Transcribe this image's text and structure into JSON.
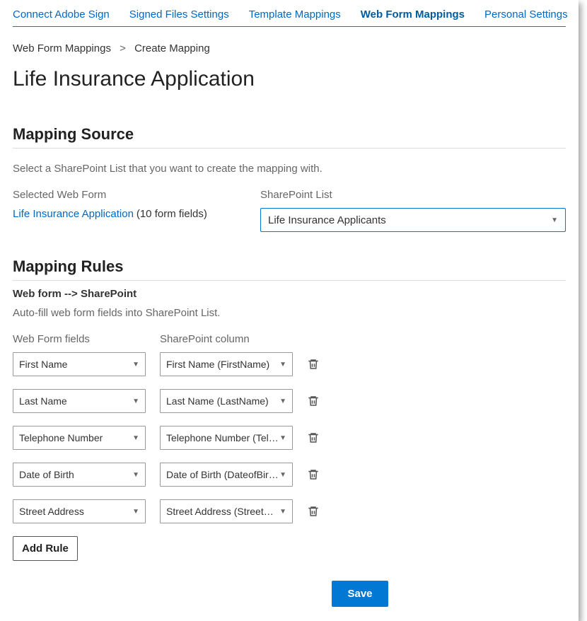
{
  "tabs": [
    {
      "label": "Connect Adobe Sign",
      "active": false
    },
    {
      "label": "Signed Files Settings",
      "active": false
    },
    {
      "label": "Template Mappings",
      "active": false
    },
    {
      "label": "Web Form Mappings",
      "active": true
    },
    {
      "label": "Personal Settings",
      "active": false
    }
  ],
  "breadcrumb": {
    "root": "Web Form Mappings",
    "sep": ">",
    "current": "Create Mapping"
  },
  "page_title": "Life Insurance Application",
  "mapping_source": {
    "title": "Mapping Source",
    "hint": "Select a SharePoint List that you want to create the mapping with.",
    "selected_webform_label": "Selected Web Form",
    "selected_webform_link": "Life Insurance Application",
    "form_fields_count": "(10 form fields)",
    "sharepoint_list_label": "SharePoint List",
    "sharepoint_list_value": "Life Insurance Applicants"
  },
  "mapping_rules": {
    "title": "Mapping Rules",
    "subsection": "Web form --> SharePoint",
    "subsection_hint": "Auto-fill web form fields into SharePoint List.",
    "col1_label": "Web Form fields",
    "col2_label": "SharePoint column",
    "rows": [
      {
        "webform": "First Name",
        "sp": "First Name (FirstName)"
      },
      {
        "webform": "Last Name",
        "sp": "Last Name (LastName)"
      },
      {
        "webform": "Telephone Number",
        "sp": "Telephone Number (Tele…"
      },
      {
        "webform": "Date of Birth",
        "sp": "Date of Birth (DateofBirth)"
      },
      {
        "webform": "Street Address",
        "sp": "Street Address (StreetAd…"
      }
    ],
    "add_rule_label": "Add Rule"
  },
  "save_label": "Save"
}
